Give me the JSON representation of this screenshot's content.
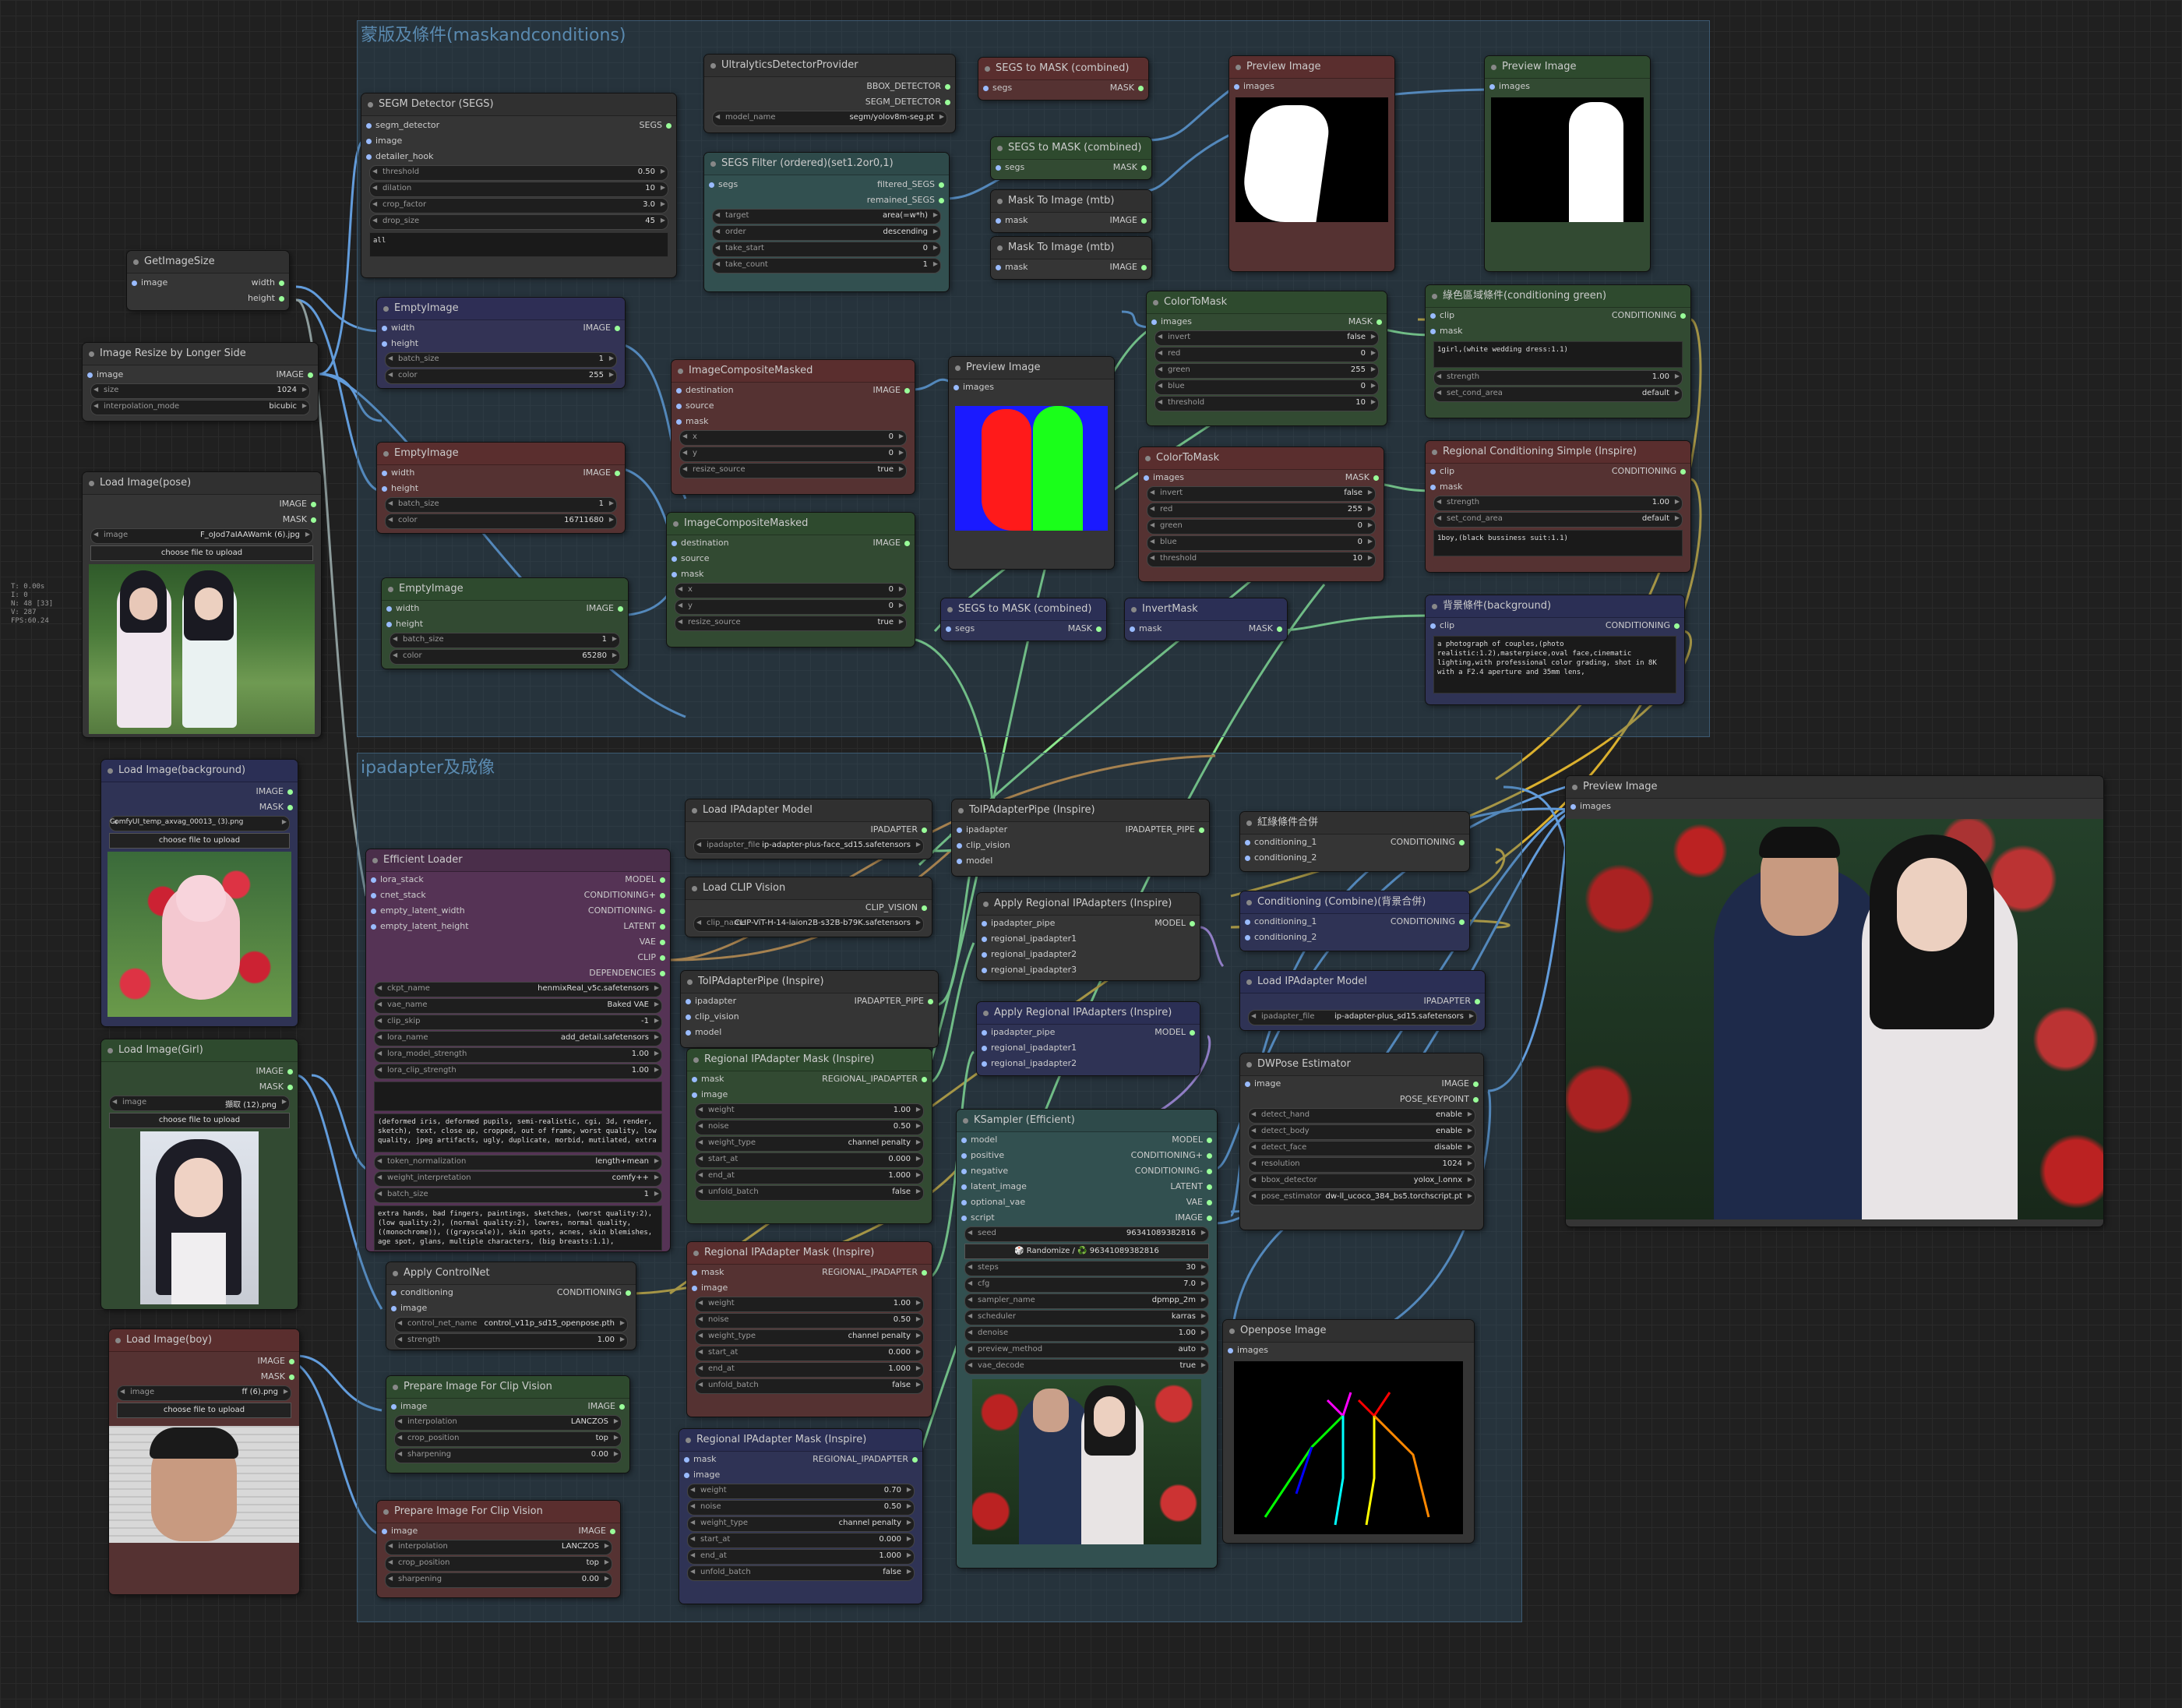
{
  "groups": {
    "mask": "蒙版及條件(maskandconditions)",
    "ipa": "ipadapter及成像"
  },
  "status": [
    "T: 0.00s",
    "I: 0",
    "N: 48 [33]",
    "V: 287",
    "FPS:60.24"
  ],
  "nodes": {
    "getimagesize": {
      "title": "GetImageSize",
      "in_image": "image",
      "out_w": "width",
      "out_h": "height"
    },
    "resize": {
      "title": "Image Resize by Longer Side",
      "in": "image",
      "out": "IMAGE",
      "size_l": "size",
      "size_v": "1024",
      "interp_l": "interpolation_mode",
      "interp_v": "bicubic"
    },
    "loadpose": {
      "title": "Load Image(pose)",
      "out1": "IMAGE",
      "out2": "MASK",
      "image_l": "image",
      "image_v": "F_oJod7aIAAWamk (6).jpg",
      "upload": "choose file to upload"
    },
    "loadbg": {
      "title": "Load Image(background)",
      "out1": "IMAGE",
      "out2": "MASK",
      "image_l": "image",
      "image_v": "ComfyUI_temp_axvag_00013_ (3).png",
      "upload": "choose file to upload"
    },
    "loadgirl": {
      "title": "Load Image(Girl)",
      "out1": "IMAGE",
      "out2": "MASK",
      "image_l": "image",
      "image_v": "擷取 (12).png",
      "upload": "choose file to upload"
    },
    "loadboy": {
      "title": "Load Image(boy)",
      "out1": "IMAGE",
      "out2": "MASK",
      "image_l": "image",
      "image_v": "ff (6).png",
      "upload": "choose file to upload"
    },
    "segm": {
      "title": "SEGM Detector (SEGS)",
      "in1": "segm_detector",
      "in2": "image",
      "in3": "detailer_hook",
      "out": "SEGS",
      "w": [
        [
          "threshold",
          "0.50"
        ],
        [
          "dilation",
          "10"
        ],
        [
          "crop_factor",
          "3.0"
        ],
        [
          "drop_size",
          "45"
        ]
      ],
      "text": "all"
    },
    "ultra": {
      "title": "UltralyticsDetectorProvider",
      "out1": "BBOX_DETECTOR",
      "out2": "SEGM_DETECTOR",
      "model_l": "model_name",
      "model_v": "segm/yolov8m-seg.pt"
    },
    "segsfilter": {
      "title": "SEGS Filter (ordered)(set1.2or0,1)",
      "in": "segs",
      "out1": "filtered_SEGS",
      "out2": "remained_SEGS",
      "w": [
        [
          "target",
          "area(=w*h)"
        ],
        [
          "order",
          "descending"
        ],
        [
          "take_start",
          "0"
        ],
        [
          "take_count",
          "1"
        ]
      ]
    },
    "segs2mask1": {
      "title": "SEGS to MASK (combined)",
      "in": "segs",
      "out": "MASK"
    },
    "segs2mask2": {
      "title": "SEGS to MASK (combined)",
      "in": "segs",
      "out": "MASK"
    },
    "segs2mask3": {
      "title": "SEGS to MASK (combined)",
      "in": "segs",
      "out": "MASK"
    },
    "mask2img1": {
      "title": "Mask To Image (mtb)",
      "in": "mask",
      "out": "IMAGE"
    },
    "mask2img2": {
      "title": "Mask To Image (mtb)",
      "in": "mask",
      "out": "IMAGE"
    },
    "preview1": {
      "title": "Preview Image",
      "in": "images"
    },
    "preview2": {
      "title": "Preview Image",
      "in": "images"
    },
    "preview3": {
      "title": "Preview Image",
      "in": "images"
    },
    "preview4": {
      "title": "Preview Image",
      "in": "images"
    },
    "empty1": {
      "title": "EmptyImage",
      "in1": "width",
      "in2": "height",
      "out": "IMAGE",
      "w": [
        [
          "batch_size",
          "1"
        ],
        [
          "color",
          "255"
        ]
      ]
    },
    "empty2": {
      "title": "EmptyImage",
      "in1": "width",
      "in2": "height",
      "out": "IMAGE",
      "w": [
        [
          "batch_size",
          "1"
        ],
        [
          "color",
          "16711680"
        ]
      ]
    },
    "empty3": {
      "title": "EmptyImage",
      "in1": "width",
      "in2": "height",
      "out": "IMAGE",
      "w": [
        [
          "batch_size",
          "1"
        ],
        [
          "color",
          "65280"
        ]
      ]
    },
    "icm1": {
      "title": "ImageCompositeMasked",
      "in1": "destination",
      "in2": "source",
      "in3": "mask",
      "out": "IMAGE",
      "w": [
        [
          "x",
          "0"
        ],
        [
          "y",
          "0"
        ],
        [
          "resize_source",
          "true"
        ]
      ]
    },
    "icm2": {
      "title": "ImageCompositeMasked",
      "in1": "destination",
      "in2": "source",
      "in3": "mask",
      "out": "IMAGE",
      "w": [
        [
          "x",
          "0"
        ],
        [
          "y",
          "0"
        ],
        [
          "resize_source",
          "true"
        ]
      ]
    },
    "ctm1": {
      "title": "ColorToMask",
      "in": "images",
      "out": "MASK",
      "w": [
        [
          "invert",
          "false"
        ],
        [
          "red",
          "0"
        ],
        [
          "green",
          "255"
        ],
        [
          "blue",
          "0"
        ],
        [
          "threshold",
          "10"
        ]
      ]
    },
    "ctm2": {
      "title": "ColorToMask",
      "in": "images",
      "out": "MASK",
      "w": [
        [
          "invert",
          "false"
        ],
        [
          "red",
          "255"
        ],
        [
          "green",
          "0"
        ],
        [
          "blue",
          "0"
        ],
        [
          "threshold",
          "10"
        ]
      ]
    },
    "invert": {
      "title": "InvertMask",
      "in": "mask",
      "out": "MASK"
    },
    "cond_green": {
      "title": "綠色區域條件(conditioning green)",
      "in1": "clip",
      "in2": "mask",
      "out": "CONDITIONING",
      "text": "1girl,(white wedding dress:1.1)",
      "w": [
        [
          "strength",
          "1.00"
        ],
        [
          "set_cond_area",
          "default"
        ]
      ]
    },
    "cond_red": {
      "title": "Regional Conditioning Simple (Inspire)",
      "in1": "clip",
      "in2": "mask",
      "out": "CONDITIONING",
      "text": "1boy,(black bussiness suit:1.1)",
      "w": [
        [
          "strength",
          "1.00"
        ],
        [
          "set_cond_area",
          "default"
        ]
      ]
    },
    "cond_bg": {
      "title": "背景條件(background)",
      "in1": "clip",
      "out": "CONDITIONING",
      "text": "a photograph of couples,(photo realistic:1.2),masterpiece,oval face,cinematic lighting,with professional color grading, shot in 8K with a F2.4 aperture and 35mm lens,"
    },
    "loadipa1": {
      "title": "Load IPAdapter Model",
      "out": "IPADAPTER",
      "model_l": "ipadapter_file",
      "model_v": "ip-adapter-plus-face_sd15.safetensors"
    },
    "loadclipv": {
      "title": "Load CLIP Vision",
      "out": "CLIP_VISION",
      "model_l": "clip_name",
      "model_v": "CLIP-ViT-H-14-laion2B-s32B-b79K.safetensors"
    },
    "topipe1": {
      "title": "ToIPAdapterPipe (Inspire)",
      "in1": "ipadapter",
      "in2": "clip_vision",
      "in3": "model",
      "out": "IPADAPTER_PIPE"
    },
    "topipe2": {
      "title": "ToIPAdapterPipe (Inspire)",
      "in1": "ipadapter",
      "in2": "clip_vision",
      "in3": "model",
      "out": "IPADAPTER_PIPE"
    },
    "combine1": {
      "title": "紅綠條件合併",
      "in1": "conditioning_1",
      "in2": "conditioning_2",
      "out": "CONDITIONING"
    },
    "combine2": {
      "title": "Conditioning (Combine)(背景合併)",
      "in1": "conditioning_1",
      "in2": "conditioning_2",
      "out": "CONDITIONING"
    },
    "apply1": {
      "title": "Apply Regional IPAdapters (Inspire)",
      "in1": "ipadapter_pipe",
      "in2": "regional_ipadapter1",
      "in3": "regional_ipadapter2",
      "in4": "regional_ipadapter3",
      "out": "MODEL"
    },
    "apply2": {
      "title": "Apply Regional IPAdapters (Inspire)",
      "in1": "ipadapter_pipe",
      "in2": "regional_ipadapter1",
      "in3": "regional_ipadapter2",
      "out": "MODEL"
    },
    "loadipa2": {
      "title": "Load IPAdapter Model",
      "out": "IPADAPTER",
      "model_l": "ipadapter_file",
      "model_v": "ip-adapter-plus_sd15.safetensors"
    },
    "effloader": {
      "title": "Efficient Loader",
      "in": [
        "lora_stack",
        "cnet_stack",
        "empty_latent_width",
        "empty_latent_height"
      ],
      "out": [
        "MODEL",
        "CONDITIONING+",
        "CONDITIONING-",
        "LATENT",
        "VAE",
        "CLIP",
        "DEPENDENCIES"
      ],
      "w": [
        [
          "ckpt_name",
          "henmixReal_v5c.safetensors"
        ],
        [
          "vae_name",
          "Baked VAE"
        ],
        [
          "clip_skip",
          "-1"
        ],
        [
          "lora_name",
          "add_detail.safetensors"
        ],
        [
          "lora_model_strength",
          "1.00"
        ],
        [
          "lora_clip_strength",
          "1.00"
        ]
      ],
      "neg": "(deformed iris, deformed pupils, semi-realistic, cgi, 3d, render, sketch), text, close up, cropped, out of frame, worst quality, low quality, jpeg artifacts, ugly, duplicate, morbid, mutilated, extra",
      "w2": [
        [
          "token_normalization",
          "length+mean"
        ],
        [
          "weight_interpretation",
          "comfy++"
        ],
        [
          "batch_size",
          "1"
        ]
      ],
      "neg2": "extra hands, bad fingers, paintings, sketches, (worst quality:2), (low quality:2), (normal quality:2), lowres, normal quality, ((monochrome)), ((grayscale)), skin spots, acnes, skin blemishes, age spot, glans, multiple characters, (big breasts:1.1),"
    },
    "cnet": {
      "title": "Apply ControlNet",
      "in1": "conditioning",
      "in2": "image",
      "out": "CONDITIONING",
      "w": [
        [
          "control_net_name",
          "control_v11p_sd15_openpose.pth"
        ],
        [
          "strength",
          "1.00"
        ]
      ]
    },
    "prep1": {
      "title": "Prepare Image For Clip Vision",
      "in": "image",
      "out": "IMAGE",
      "w": [
        [
          "interpolation",
          "LANCZOS"
        ],
        [
          "crop_position",
          "top"
        ],
        [
          "sharpening",
          "0.00"
        ]
      ]
    },
    "prep2": {
      "title": "Prepare Image For Clip Vision",
      "in": "image",
      "out": "IMAGE",
      "w": [
        [
          "interpolation",
          "LANCZOS"
        ],
        [
          "crop_position",
          "top"
        ],
        [
          "sharpening",
          "0.00"
        ]
      ]
    },
    "rmask1": {
      "title": "Regional IPAdapter Mask (Inspire)",
      "in1": "mask",
      "in2": "image",
      "out": "REGIONAL_IPADAPTER",
      "w": [
        [
          "weight",
          "1.00"
        ],
        [
          "noise",
          "0.50"
        ],
        [
          "weight_type",
          "channel penalty"
        ],
        [
          "start_at",
          "0.000"
        ],
        [
          "end_at",
          "1.000"
        ],
        [
          "unfold_batch",
          "false"
        ]
      ]
    },
    "rmask2": {
      "title": "Regional IPAdapter Mask (Inspire)",
      "in1": "mask",
      "in2": "image",
      "out": "REGIONAL_IPADAPTER",
      "w": [
        [
          "weight",
          "1.00"
        ],
        [
          "noise",
          "0.50"
        ],
        [
          "weight_type",
          "channel penalty"
        ],
        [
          "start_at",
          "0.000"
        ],
        [
          "end_at",
          "1.000"
        ],
        [
          "unfold_batch",
          "false"
        ]
      ]
    },
    "rmask3": {
      "title": "Regional IPAdapter Mask (Inspire)",
      "in1": "mask",
      "in2": "image",
      "out": "REGIONAL_IPADAPTER",
      "w": [
        [
          "weight",
          "0.70"
        ],
        [
          "noise",
          "0.50"
        ],
        [
          "weight_type",
          "channel penalty"
        ],
        [
          "start_at",
          "0.000"
        ],
        [
          "end_at",
          "1.000"
        ],
        [
          "unfold_batch",
          "false"
        ]
      ]
    },
    "ksampler": {
      "title": "KSampler (Efficient)",
      "in": [
        "model",
        "positive",
        "negative",
        "latent_image",
        "optional_vae",
        "script"
      ],
      "out": [
        "MODEL",
        "CONDITIONING+",
        "CONDITIONING-",
        "LATENT",
        "VAE",
        "IMAGE"
      ],
      "seed_l": "seed",
      "seed_v": "963410893828​16",
      "randomize": "🎲 Randomize / ♻️ 963410893828​16",
      "w": [
        [
          "steps",
          "30"
        ],
        [
          "cfg",
          "7.0"
        ],
        [
          "sampler_name",
          "dpmpp_2m"
        ],
        [
          "scheduler",
          "karras"
        ],
        [
          "denoise",
          "1.00"
        ],
        [
          "preview_method",
          "auto"
        ],
        [
          "vae_decode",
          "true"
        ]
      ]
    },
    "dwpose": {
      "title": "DWPose Estimator",
      "in": "image",
      "out1": "IMAGE",
      "out2": "POSE_KEYPOINT",
      "w": [
        [
          "detect_hand",
          "enable"
        ],
        [
          "detect_body",
          "enable"
        ],
        [
          "detect_face",
          "disable"
        ],
        [
          "resolution",
          "1024"
        ],
        [
          "bbox_detector",
          "yolox_l.onnx"
        ],
        [
          "pose_estimator",
          "dw-ll_ucoco_384_bs5.torchscript.pt"
        ]
      ]
    },
    "openpose": {
      "title": "Openpose Image",
      "in": "images"
    },
    "previewfinal": {
      "title": "Preview Image",
      "in": "images"
    }
  }
}
